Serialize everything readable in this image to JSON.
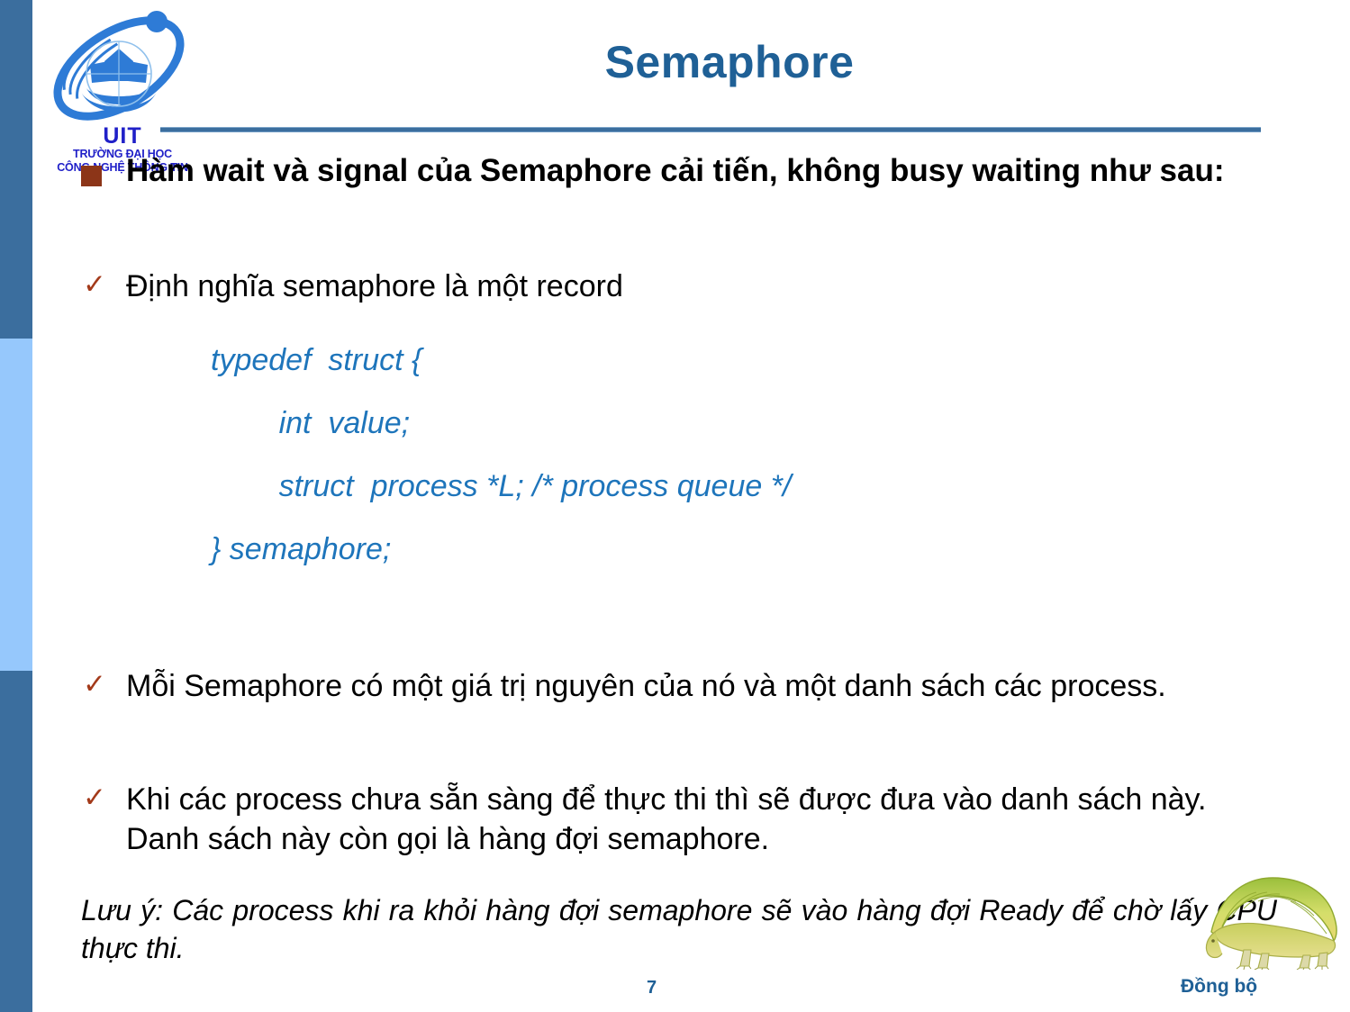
{
  "slide": {
    "title": "Semaphore",
    "number": "7",
    "footer_label": "Đồng bộ",
    "accent_dark_blue": "#3B6E9E",
    "accent_light_blue": "#96C8FC",
    "title_color": "#1F6096",
    "code_color": "#1E75BB",
    "bullet_color": "#8C3518",
    "check_color": "#A33A1A"
  },
  "logo": {
    "acronym": "UIT",
    "line1": "TRƯỜNG ĐẠI HỌC",
    "line2": "CÔNG NGHỆ THÔNG TIN",
    "mark_color": "#2E7BD6",
    "text_color": "#2020C8"
  },
  "content": {
    "bullet1": "Hàm wait và signal của Semaphore cải tiến, không busy waiting như sau:",
    "sub1": "Định nghĩa semaphore là một record",
    "code": [
      "typedef  struct {",
      "        int  value;",
      "        struct  process *L; /* process queue */",
      "} semaphore;"
    ],
    "sub2": "Mỗi Semaphore có một giá trị nguyên của nó và một danh sách các process.",
    "sub3": "Khi các process chưa sẵn sàng để thực thi thì sẽ được đưa vào danh sách này. Danh sách này còn gọi là hàng đợi semaphore.",
    "note": "Lưu ý: Các process khi ra khỏi hàng đợi semaphore sẽ vào hàng đợi Ready để chờ lấy CPU thực thi."
  }
}
